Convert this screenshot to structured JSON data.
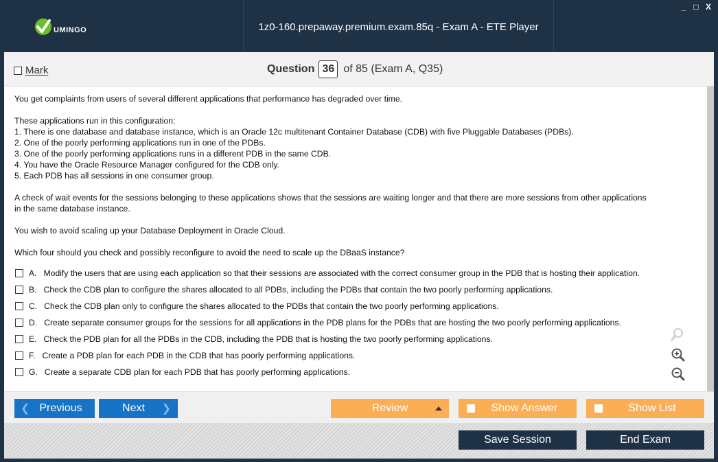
{
  "window": {
    "title": "1z0-160.prepaway.premium.exam.85q - Exam A - ETE Player",
    "logo_text": "UMINGO",
    "controls": [
      "_",
      "□",
      "X"
    ]
  },
  "header": {
    "mark_label": "Mark",
    "question_label": "Question",
    "question_number": "36",
    "question_of": "of 85 (Exam A, Q35)"
  },
  "question": {
    "p1": "You get complaints from users of several different applications that performance has degraded over time.",
    "p2_lines": [
      "These applications run in this configuration:",
      "1. There is one database and database instance, which is an Oracle 12c multitenant Container Database (CDB) with five Pluggable Databases (PDBs).",
      "2. One of the poorly performing applications run in one of the PDBs.",
      "3. One of the poorly performing applications runs in a different PDB in the same CDB.",
      "4. You have the Oracle Resource Manager configured for the CDB only.",
      "5. Each PDB has all sessions in one consumer group."
    ],
    "p3_lines": [
      "A check of wait events for the sessions belonging to these applications shows that the sessions are waiting longer and that there are more sessions from other applications",
      "in the same database instance."
    ],
    "p4": "You wish to avoid scaling up your Database Deployment in Oracle Cloud.",
    "p5": "Which four should you check and possibly reconfigure to avoid the need to scale up the DBaaS instance?",
    "options": [
      {
        "letter": "A.",
        "text": "Modify the users that are using each application so that their sessions are associated with the correct consumer group in the PDB that is hosting their application."
      },
      {
        "letter": "B.",
        "text": "Check the CDB plan to configure the shares allocated to all PDBs, including the PDBs that contain the two poorly performing applications."
      },
      {
        "letter": "C.",
        "text": "Check the CDB plan only to configure the shares allocated to the PDBs that contain the two poorly performing applications."
      },
      {
        "letter": "D.",
        "text": "Create separate consumer groups for the sessions for all applications in the PDB plans for the PDBs that are hosting the two poorly performing applications."
      },
      {
        "letter": "E.",
        "text": "Check the PDB plan for all the PDBs in the CDB, including the PDB that is hosting the two poorly performing applications."
      },
      {
        "letter": "F.",
        "text": "Create a PDB plan for each PDB in the CDB that has poorly performing applications."
      },
      {
        "letter": "G.",
        "text": "Create a separate CDB plan for each PDB that has poorly performing applications."
      }
    ]
  },
  "toolbar": {
    "previous_label": "Previous",
    "next_label": "Next",
    "review_label": "Review",
    "show_answer_label": "Show Answer",
    "show_list_label": "Show List",
    "save_session_label": "Save Session",
    "end_exam_label": "End Exam"
  },
  "colors": {
    "titlebar": "#1f3245",
    "blue_button": "#1673c5",
    "orange_button": "#fbae54",
    "dark_button": "#1f3245"
  },
  "icons": {
    "logo": "check-circle-logo-icon",
    "zoom_search": "magnifier-icon",
    "zoom_in": "zoom-in-icon",
    "zoom_out": "zoom-out-icon"
  }
}
